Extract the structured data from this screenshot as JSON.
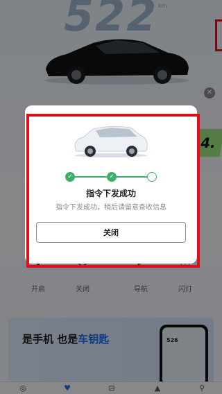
{
  "range": {
    "value": "522",
    "unit": "km"
  },
  "promo_tag": {
    "label": "4."
  },
  "controls": [
    {
      "label": "开启",
      "icon": "fan-icon"
    },
    {
      "label": "关闭",
      "icon": "power-icon"
    },
    {
      "label": "导航",
      "icon": "navigation-icon"
    },
    {
      "label": "闪灯",
      "icon": "warning-light-icon"
    }
  ],
  "banner": {
    "text_a": "是手机 也是",
    "text_b": "车钥匙",
    "phone_value": "526"
  },
  "dialog": {
    "title": "指令下发成功",
    "subtitle": "指令下发成功，稍后请留意查收信息",
    "close_label": "关闭",
    "steps": [
      "done",
      "done",
      "pending"
    ]
  },
  "colors": {
    "success": "#3cae6a",
    "highlight": "#e0101a",
    "accent": "#1e6de0"
  }
}
